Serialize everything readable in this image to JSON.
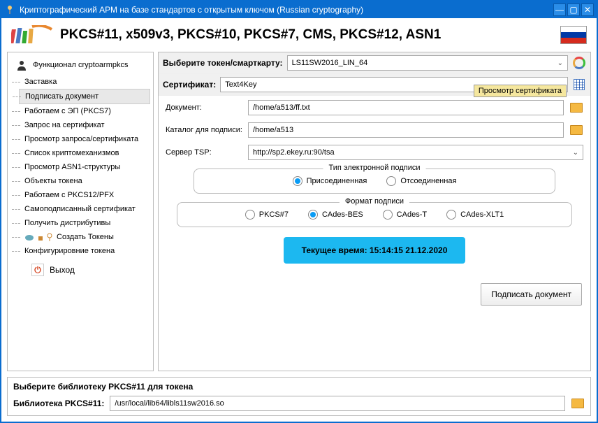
{
  "window": {
    "title": "Криптографический АРМ на базе стандартов с открытым ключом (Russian cryptography)"
  },
  "header": {
    "title": "PKCS#11, x509v3, PKCS#10, PKCS#7, CMS, PKCS#12, ASN1"
  },
  "sidebar": {
    "root": "Функционал cryptoarmpkcs",
    "items": [
      "Заставка",
      "Подписать документ",
      "Работаем с ЭП (PKCS7)",
      "Запрос на сертификат",
      "Просмотр запроса/сертификата",
      "Список криптомеханизмов",
      "Просмотр ASN1-структуры",
      "Объекты токена",
      "Работаем с PKCS12/PFX",
      "Самоподписанный сертификат",
      "Получить дистрибутивы",
      "Создать Токены",
      "Конфигурировние токена"
    ],
    "selected_index": 1,
    "exit": "Выход"
  },
  "content": {
    "token_label": "Выберите токен/смарткарту:",
    "token_value": "LS11SW2016_LIN_64",
    "cert_label": "Сертификат:",
    "cert_value": "Text4Key",
    "tooltip": "Просмотр сертификата",
    "doc_label": "Документ:",
    "doc_value": "/home/a513/ff.txt",
    "sigdir_label": "Каталог для подписи:",
    "sigdir_value": "/home/a513",
    "tsp_label": "Сервер TSP:",
    "tsp_value": "http://sp2.ekey.ru:90/tsa",
    "sigtype_legend": "Тип электронной подписи",
    "sigtype_options": [
      "Присоединенная",
      "Отсоединенная"
    ],
    "sigtype_selected": 0,
    "sigformat_legend": "Формат подписи",
    "sigformat_options": [
      "PKCS#7",
      "CAdes-BES",
      "CAdes-T",
      "CAdes-XLT1"
    ],
    "sigformat_selected": 1,
    "time_label": "Текущее время: 15:14:15 21.12.2020",
    "submit": "Подписать  документ"
  },
  "footer": {
    "title": "Выберите библиотеку PKCS#11 для токена",
    "lib_label": "Библиотека PKCS#11:",
    "lib_value": "/usr/local/lib64/libls11sw2016.so"
  }
}
